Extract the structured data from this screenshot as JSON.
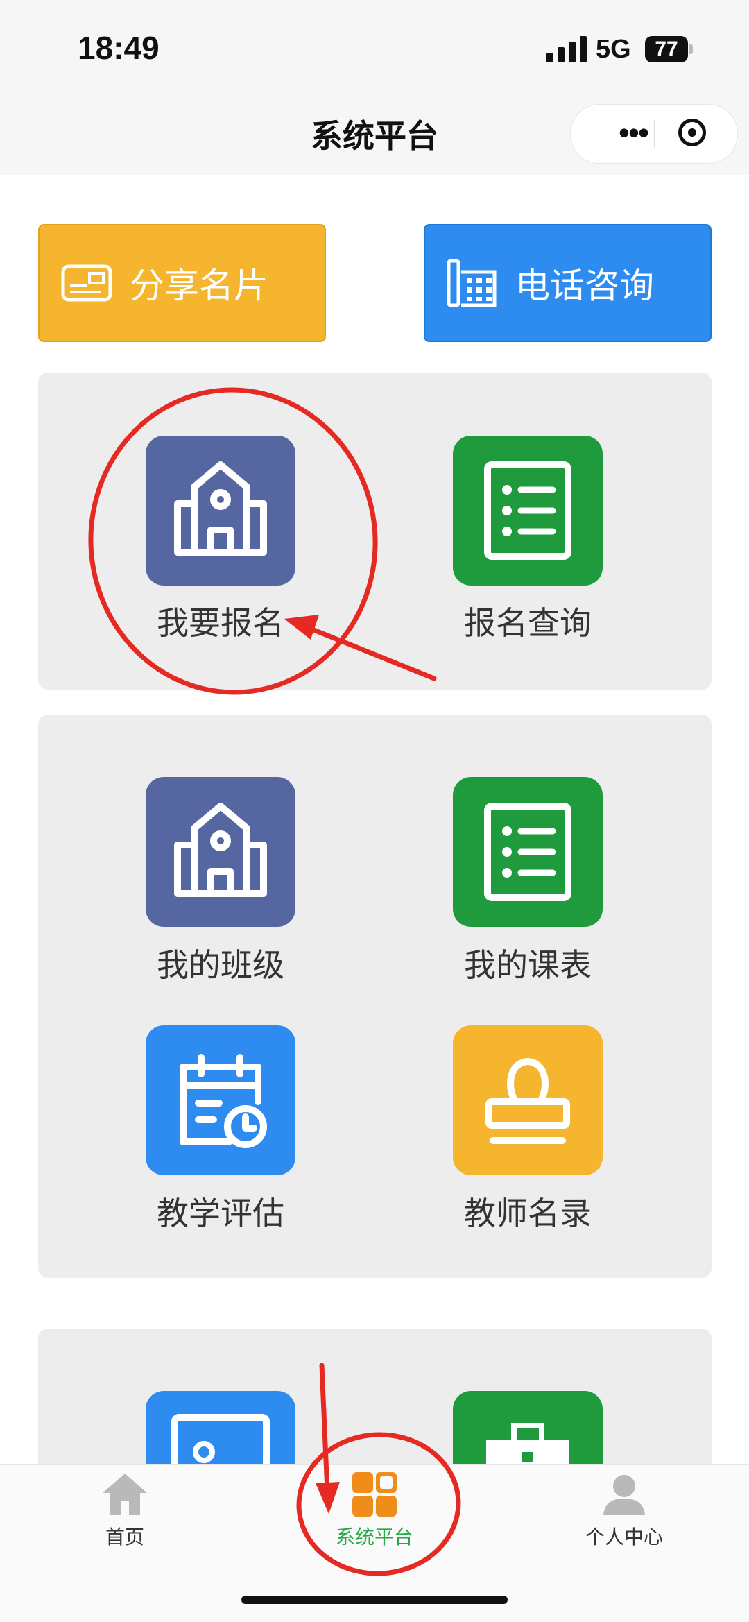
{
  "status_bar": {
    "time": "18:49",
    "network": "5G",
    "battery": "77"
  },
  "nav": {
    "title": "系统平台",
    "more_label": "•••"
  },
  "actions": {
    "share_label": "分享名片",
    "phone_label": "电话咨询"
  },
  "panel1": {
    "items": [
      {
        "label": "我要报名"
      },
      {
        "label": "报名查询"
      }
    ]
  },
  "panel2": {
    "items": [
      {
        "label": "我的班级"
      },
      {
        "label": "我的课表"
      },
      {
        "label": "教学评估"
      },
      {
        "label": "教师名录"
      }
    ]
  },
  "tabbar": {
    "items": [
      {
        "label": "首页"
      },
      {
        "label": "系统平台"
      },
      {
        "label": "个人中心"
      }
    ],
    "active_color": "#25a845"
  },
  "colors": {
    "navy": "#5566a0",
    "green": "#1f9a3c",
    "blue": "#2e8cf0",
    "orange": "#f5b52f",
    "annotation": "#e52a23"
  },
  "icons": {
    "share": "business-card-icon",
    "phone": "office-phone-icon",
    "enroll": "school-building-icon",
    "enroll_query": "list-icon",
    "my_class": "school-building-icon",
    "my_schedule": "list-icon",
    "evaluation": "calendar-clock-icon",
    "teachers": "stamp-icon"
  }
}
